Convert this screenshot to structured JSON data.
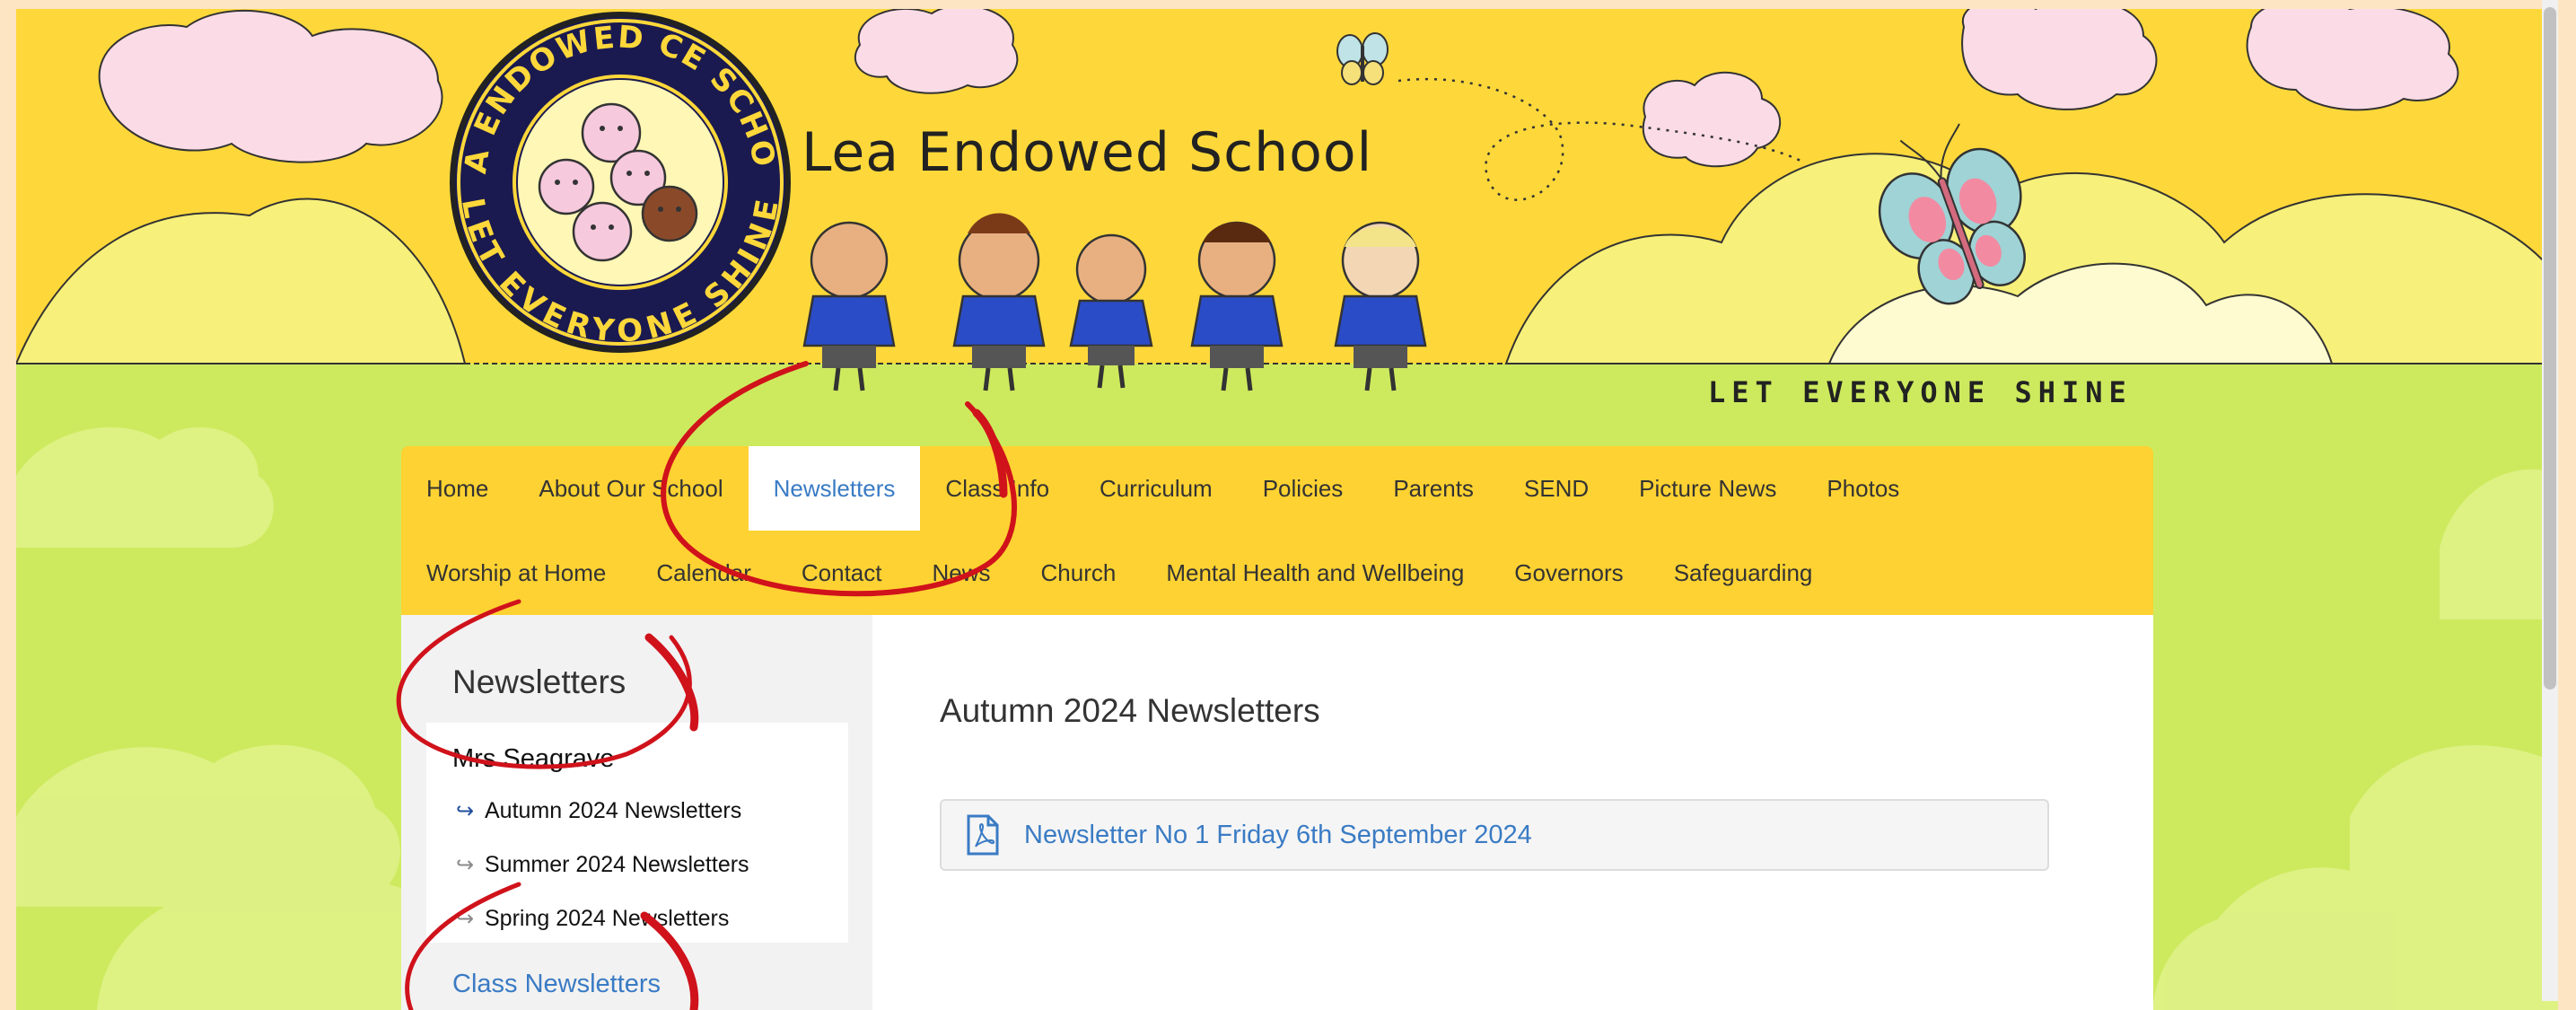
{
  "header": {
    "school_name": "Lea Endowed School",
    "tagline": "LET EVERYONE SHINE",
    "logo": {
      "ring_text_top": "LEA ENDOWED CE SCHOOL",
      "ring_text_bottom": "LET EVERYONE SHINE"
    }
  },
  "nav": {
    "row1": [
      "Home",
      "About Our School",
      "Newsletters",
      "Class Info",
      "Curriculum",
      "Policies",
      "Parents",
      "SEND",
      "Picture News",
      "Photos"
    ],
    "row2": [
      "Worship at Home",
      "Calendar",
      "Contact",
      "News",
      "Church",
      "Mental Health and Wellbeing",
      "Governors",
      "Safeguarding"
    ],
    "active": "Newsletters"
  },
  "sidebar": {
    "title": "Newsletters",
    "section_heading": "Mrs Seagrave",
    "items": [
      "Autumn 2024 Newsletters",
      "Summer 2024 Newsletters",
      "Spring 2024 Newsletters"
    ],
    "class_link": "Class Newsletters"
  },
  "main": {
    "title": "Autumn 2024 Newsletters",
    "files": [
      {
        "label": "Newsletter No 1 Friday 6th September 2024",
        "icon": "pdf-icon"
      }
    ]
  },
  "colors": {
    "sky_yellow": "#fed83a",
    "grass_green": "#cdea5e",
    "nav_bar": "#fed232",
    "link_blue": "#3a7bc4",
    "annotation_red": "#d0121b",
    "page_border": "#fde5c4"
  }
}
